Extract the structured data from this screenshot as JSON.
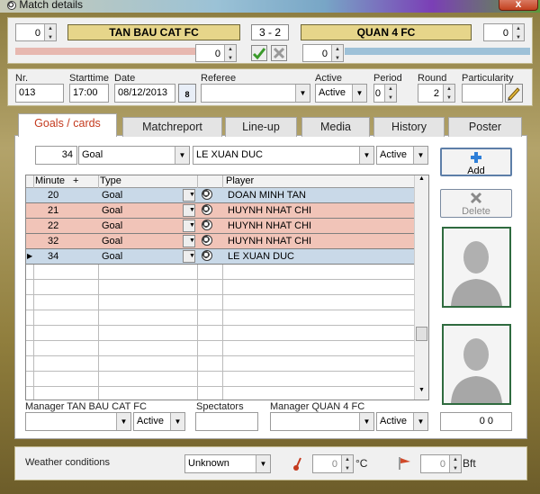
{
  "window": {
    "title": "Match details",
    "close_glyph": "x"
  },
  "score": {
    "home_spin": "0",
    "home_team": "TAN BAU CAT FC",
    "result": "3  - 2",
    "away_team": "QUAN 4 FC",
    "away_spin": "0",
    "home_sub_spin": "0",
    "away_sub_spin": "0"
  },
  "info": {
    "nr_label": "Nr.",
    "nr_value": "013",
    "starttime_label": "Starttime",
    "starttime_value": "17:00",
    "date_label": "Date",
    "date_value": "08/12/2013",
    "calendar_day": "8",
    "referee_label": "Referee",
    "referee_value": "",
    "active_label": "Active",
    "active_value": "Active",
    "period_label": "Period",
    "period_value": "0",
    "round_label": "Round",
    "round_value": "2",
    "particularity_label": "Particularity",
    "particularity_value": ""
  },
  "tabs": [
    "Goals / cards",
    "Matchreport",
    "Line-up",
    "Media",
    "History",
    "Poster"
  ],
  "entry": {
    "minute": "34",
    "type": "Goal",
    "player": "LE XUAN DUC",
    "status": "Active"
  },
  "grid": {
    "headers": {
      "minute": "Minute",
      "plus": "+",
      "type": "Type",
      "player": "Player"
    },
    "rows": [
      {
        "minute": "20",
        "type": "Goal",
        "player": "DOAN MINH TAN",
        "color": "#c9d9e8"
      },
      {
        "minute": "21",
        "type": "Goal",
        "player": "HUYNH NHAT CHI",
        "color": "#f1c4b8"
      },
      {
        "minute": "22",
        "type": "Goal",
        "player": "HUYNH NHAT CHI",
        "color": "#f1c4b8"
      },
      {
        "minute": "32",
        "type": "Goal",
        "player": "HUYNH NHAT CHI",
        "color": "#f1c4b8"
      },
      {
        "minute": "34",
        "type": "Goal",
        "player": "LE XUAN DUC",
        "color": "#c9d9e8"
      }
    ]
  },
  "buttons": {
    "add": "Add",
    "delete": "Delete"
  },
  "managers": {
    "home_label": "Manager TAN BAU CAT FC",
    "home_value": "",
    "home_status": "Active",
    "spectators_label": "Spectators",
    "spectators_value": "",
    "away_label": "Manager QUAN 4 FC",
    "away_value": "",
    "away_status": "Active",
    "total": "0 0"
  },
  "weather": {
    "label": "Weather conditions",
    "condition": "Unknown",
    "temp_value": "0",
    "temp_unit": "°C",
    "wind_value": "0",
    "wind_unit": "Bft"
  }
}
